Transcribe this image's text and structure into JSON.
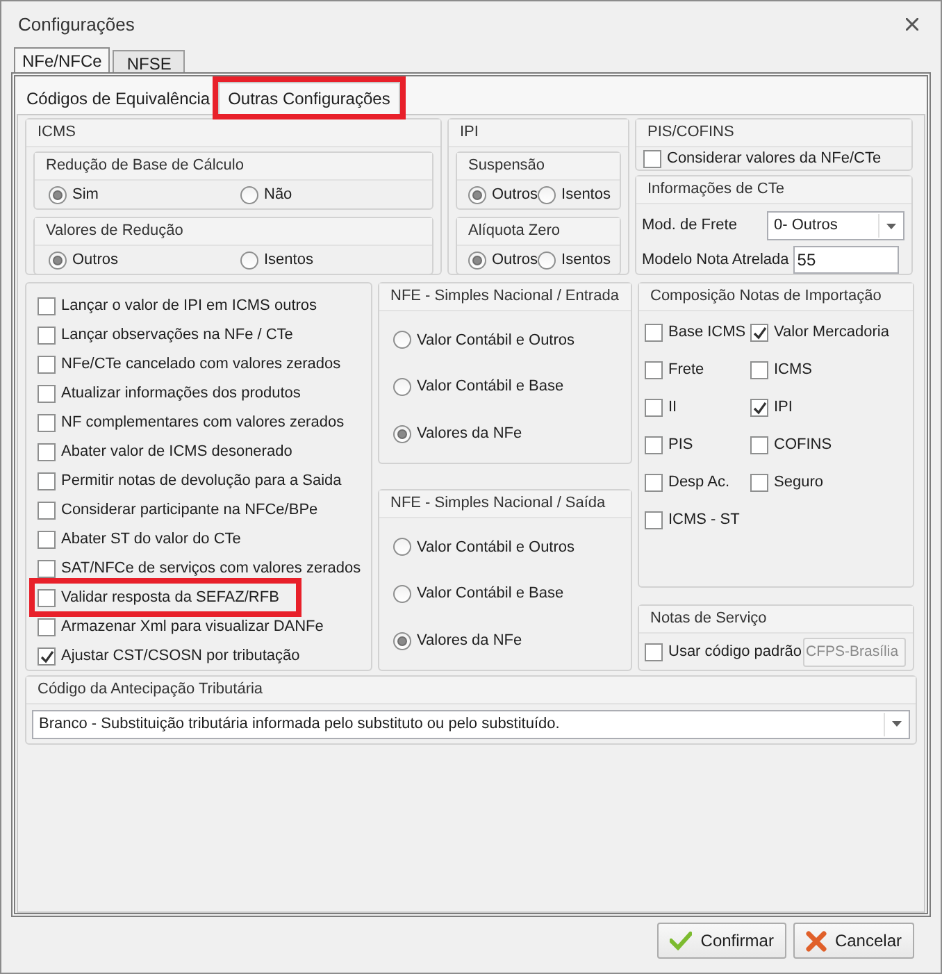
{
  "window": {
    "title": "Configurações"
  },
  "tabs": [
    {
      "label": "NFe/NFCe",
      "selected": true
    },
    {
      "label": "NFSE",
      "selected": false
    }
  ],
  "subtabs": [
    {
      "label": "Códigos de Equivalência",
      "selected": false,
      "highlighted": false
    },
    {
      "label": "Outras Configurações",
      "selected": true,
      "highlighted": true
    }
  ],
  "icms": {
    "title": "ICMS",
    "groups": [
      {
        "title": "Redução de Base de Cálculo",
        "options": [
          {
            "label": "Sim",
            "selected": true
          },
          {
            "label": "Não",
            "selected": false
          }
        ]
      },
      {
        "title": "Valores de Redução",
        "options": [
          {
            "label": "Outros",
            "selected": true
          },
          {
            "label": "Isentos",
            "selected": false
          }
        ]
      }
    ]
  },
  "ipi": {
    "title": "IPI",
    "groups": [
      {
        "title": "Suspensão",
        "options": [
          {
            "label": "Outros",
            "selected": true
          },
          {
            "label": "Isentos",
            "selected": false
          }
        ]
      },
      {
        "title": "Alíquota Zero",
        "options": [
          {
            "label": "Outros",
            "selected": true
          },
          {
            "label": "Isentos",
            "selected": false
          }
        ]
      }
    ]
  },
  "pis_cofins": {
    "title": "PIS/COFINS",
    "checkbox": {
      "label": "Considerar valores da NFe/CTe",
      "checked": false
    }
  },
  "cte": {
    "title": "Informações de CTe",
    "mod_frete": {
      "label": "Mod. de Frete",
      "value": "0- Outros"
    },
    "modelo_nota": {
      "label": "Modelo Nota Atrelada",
      "value": "55"
    }
  },
  "options": [
    {
      "label": "Lançar o valor de IPI em ICMS outros",
      "checked": false,
      "highlighted": false
    },
    {
      "label": "Lançar observações na NFe / CTe",
      "checked": false,
      "highlighted": false
    },
    {
      "label": "NFe/CTe cancelado com valores zerados",
      "checked": false,
      "highlighted": false
    },
    {
      "label": "Atualizar informações dos produtos",
      "checked": false,
      "highlighted": false
    },
    {
      "label": "NF complementares com valores zerados",
      "checked": false,
      "highlighted": false
    },
    {
      "label": "Abater valor de ICMS desonerado",
      "checked": false,
      "highlighted": false
    },
    {
      "label": "Permitir notas de devolução para a Saida",
      "checked": false,
      "highlighted": false
    },
    {
      "label": "Considerar participante na NFCe/BPe",
      "checked": false,
      "highlighted": false
    },
    {
      "label": "Abater ST do valor do CTe",
      "checked": false,
      "highlighted": false
    },
    {
      "label": "SAT/NFCe de serviços com valores zerados",
      "checked": false,
      "highlighted": false
    },
    {
      "label": "Validar resposta da SEFAZ/RFB",
      "checked": false,
      "highlighted": true
    },
    {
      "label": "Armazenar Xml para visualizar DANFe",
      "checked": false,
      "highlighted": false
    },
    {
      "label": "Ajustar CST/CSOSN por tributação",
      "checked": true,
      "highlighted": false
    }
  ],
  "simples_entrada": {
    "title": "NFE - Simples Nacional / Entrada",
    "options": [
      {
        "label": "Valor Contábil e Outros",
        "selected": false
      },
      {
        "label": "Valor Contábil e Base",
        "selected": false
      },
      {
        "label": "Valores da NFe",
        "selected": true
      }
    ]
  },
  "simples_saida": {
    "title": "NFE - Simples Nacional / Saída",
    "options": [
      {
        "label": "Valor Contábil e Outros",
        "selected": false
      },
      {
        "label": "Valor Contábil e Base",
        "selected": false
      },
      {
        "label": "Valores da NFe",
        "selected": true
      }
    ]
  },
  "importacao": {
    "title": "Composição Notas de Importação",
    "items": [
      {
        "label": "Base ICMS",
        "checked": false
      },
      {
        "label": "Valor Mercadoria",
        "checked": true
      },
      {
        "label": "Frete",
        "checked": false
      },
      {
        "label": "ICMS",
        "checked": false
      },
      {
        "label": "II",
        "checked": false
      },
      {
        "label": "IPI",
        "checked": true
      },
      {
        "label": "PIS",
        "checked": false
      },
      {
        "label": "COFINS",
        "checked": false
      },
      {
        "label": "Desp Ac.",
        "checked": false
      },
      {
        "label": "Seguro",
        "checked": false
      },
      {
        "label": "ICMS - ST",
        "checked": false
      }
    ]
  },
  "notas_servico": {
    "title": "Notas de Serviço",
    "checkbox": {
      "label": "Usar código padrão",
      "checked": false
    },
    "field": {
      "value": "CFPS-Brasília",
      "disabled": true
    }
  },
  "antecipacao": {
    "title": "Código da Antecipação Tributária",
    "value": "Branco - Substituição tributária informada pelo substituto ou pelo substituído."
  },
  "buttons": [
    {
      "label": "Confirmar",
      "kind": "confirm"
    },
    {
      "label": "Cancelar",
      "kind": "cancel"
    }
  ]
}
